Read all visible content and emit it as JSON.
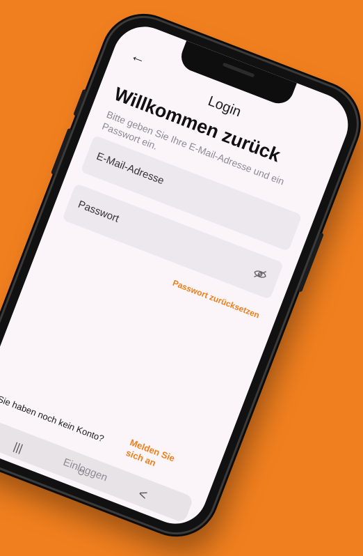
{
  "screen": {
    "title": "Login",
    "headline": "Willkommen zurück",
    "subtitle": "Bitte geben Sie Ihre E-Mail-Adresse und ein Passwort ein.",
    "email_label": "E-Mail-Adresse",
    "password_label": "Passwort",
    "reset_link": "Passwort zurücksetzen",
    "signup_question": "Sie haben noch kein Konto?",
    "signup_link": "Melden Sie sich an",
    "login_button": "Einloggen"
  },
  "colors": {
    "background": "#f07f1f",
    "accent": "#ef7f1a"
  },
  "icons": {
    "back": "back-arrow-icon",
    "password_visibility": "eye-off-icon"
  },
  "nav": {
    "recents_glyph": "|||",
    "home_glyph": "○",
    "back_glyph": "<"
  }
}
